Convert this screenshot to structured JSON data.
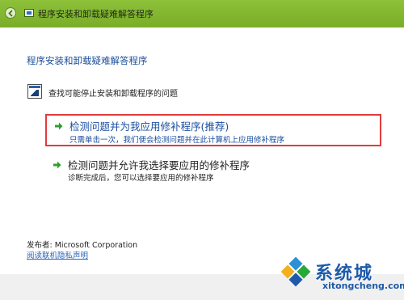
{
  "window": {
    "title": "程序安装和卸载疑难解答程序"
  },
  "main": {
    "heading": "程序安装和卸载疑难解答程序",
    "description": "查找可能停止安装和卸载程序的问题",
    "options": [
      {
        "title": "检测问题并为我应用修补程序(推荐)",
        "subtitle": "只需单击一次，我们便会检测问题并在此计算机上应用修补程序"
      },
      {
        "title": "检测问题并允许我选择要应用的修补程序",
        "subtitle": "诊断完成后，您可以选择要应用的修补程序"
      }
    ],
    "publisher": "发布者: Microsoft Corporation",
    "privacy_link": "阅读联机隐私声明"
  },
  "watermark": {
    "brand": "系统城",
    "url": "xitongcheng.com"
  },
  "colors": {
    "titlebar": "#79ad28",
    "highlight_border": "#e23b3b",
    "link_blue": "#1a4fa0",
    "arrow_green": "#2ea02a"
  }
}
